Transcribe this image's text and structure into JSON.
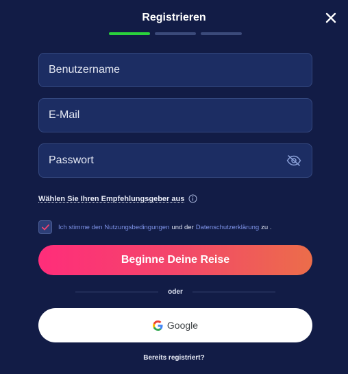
{
  "header": {
    "title": "Registrieren",
    "close_icon": "close-icon",
    "steps": [
      {
        "state": "active"
      },
      {
        "state": "inactive"
      },
      {
        "state": "inactive"
      }
    ]
  },
  "form": {
    "username_placeholder": "Benutzername",
    "email_placeholder": "E-Mail",
    "password_placeholder": "Passwort",
    "password_toggle_icon": "eye-off-icon"
  },
  "referral": {
    "label": "Wählen Sie Ihren Empfehlungsgeber aus",
    "info_icon": "info-icon"
  },
  "terms": {
    "checked": true,
    "prefix": "Ich stimme den",
    "terms_link": "Nutzungsbedingungen",
    "and": "und der",
    "privacy_link": "Datenschutzerklärung",
    "suffix": "zu ."
  },
  "cta": {
    "label": "Beginne Deine Reise"
  },
  "divider": {
    "label": "oder"
  },
  "google": {
    "label": "Google",
    "icon": "google-icon"
  },
  "footer": {
    "already_registered": "Bereits registriert?"
  },
  "colors": {
    "background": "#121c46",
    "field_bg": "#1c2d63",
    "step_active": "#2ad23c",
    "cta_start": "#ff2d7a",
    "cta_end": "#ec6d4a",
    "link": "#7d92e6"
  }
}
